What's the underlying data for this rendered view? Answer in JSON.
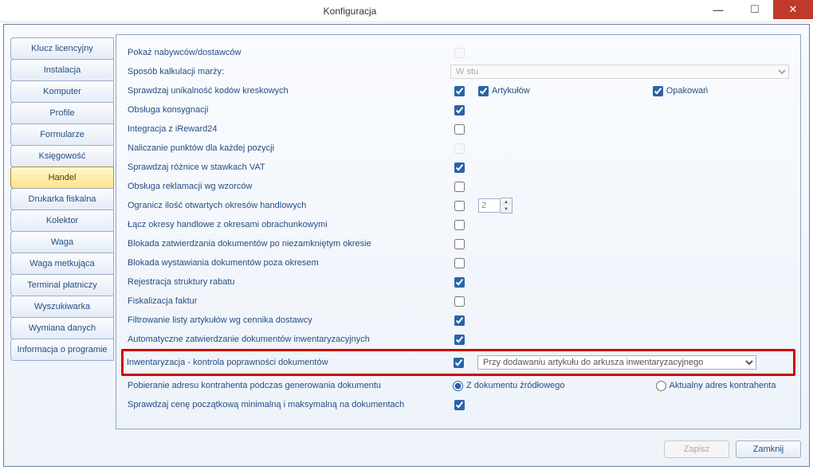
{
  "window": {
    "title": "Konfiguracja"
  },
  "win_btns": {
    "min": "—",
    "max": "☐",
    "close": "✕"
  },
  "sidebar": {
    "items": [
      {
        "label": "Klucz licencyjny"
      },
      {
        "label": "Instalacja"
      },
      {
        "label": "Komputer"
      },
      {
        "label": "Profile"
      },
      {
        "label": "Formularze"
      },
      {
        "label": "Księgowość"
      },
      {
        "label": "Handel",
        "active": true
      },
      {
        "label": "Drukarka fiskalna"
      },
      {
        "label": "Kolektor"
      },
      {
        "label": "Waga"
      },
      {
        "label": "Waga metkująca"
      },
      {
        "label": "Terminal płatniczy"
      },
      {
        "label": "Wyszukiwarka"
      },
      {
        "label": "Wymiana danych"
      },
      {
        "label": "Informacja o programie"
      }
    ]
  },
  "rows": [
    {
      "label": "Pokaż nabywców/dostawców",
      "checked": false,
      "disabled": true
    },
    {
      "label": "Sposób kalkulacji marży:",
      "select_muted": true,
      "select": "W stu"
    },
    {
      "label": "Sprawdzaj unikalność kodów kreskowych",
      "checked": true,
      "extra_checks": [
        {
          "label": "Artykułów",
          "checked": true
        },
        {
          "label": "Opakowań",
          "checked": true
        }
      ]
    },
    {
      "label": "Obsługa konsygnacji",
      "checked": true
    },
    {
      "label": "Integracja z iReward24",
      "checked": false
    },
    {
      "label": "Naliczanie punktów dla każdej pozycji",
      "checked": false,
      "disabled": true
    },
    {
      "label": "Sprawdzaj różnice w stawkach VAT",
      "checked": true
    },
    {
      "label": "Obsługa reklamacji wg wzorców",
      "checked": false
    },
    {
      "label": "Ogranicz ilość otwartych okresów handlowych",
      "checked": false,
      "spin": "2"
    },
    {
      "label": "Łącz okresy handlowe z okresami obrachunkowymi",
      "checked": false
    },
    {
      "label": "Blokada zatwierdzania dokumentów po niezamkniętym okresie",
      "checked": false
    },
    {
      "label": "Blokada wystawiania dokumentów poza okresem",
      "checked": false
    },
    {
      "label": "Rejestracja struktury rabatu",
      "checked": true
    },
    {
      "label": "Fiskalizacja faktur",
      "checked": false
    },
    {
      "label": "Filtrowanie listy artykułów wg cennika dostawcy",
      "checked": true
    },
    {
      "label": "Automatyczne zatwierdzanie dokumentów inwentaryzacyjnych",
      "checked": true
    },
    {
      "label": "Inwentaryzacja - kontrola poprawności dokumentów",
      "checked": true,
      "highlight": true,
      "select": "Przy dodawaniu artykułu do arkusza inwentaryzacyjnego"
    },
    {
      "label": "Pobieranie adresu kontrahenta podczas generowania dokumentu",
      "radios": [
        {
          "label": "Z dokumentu źródłowego",
          "checked": true
        },
        {
          "label": "Aktualny adres kontrahenta",
          "checked": false
        }
      ]
    },
    {
      "label": "Sprawdzaj cenę początkową minimalną i maksymalną na dokumentach",
      "checked": true
    }
  ],
  "buttons": {
    "save": "Zapisz",
    "close": "Zamknij"
  }
}
